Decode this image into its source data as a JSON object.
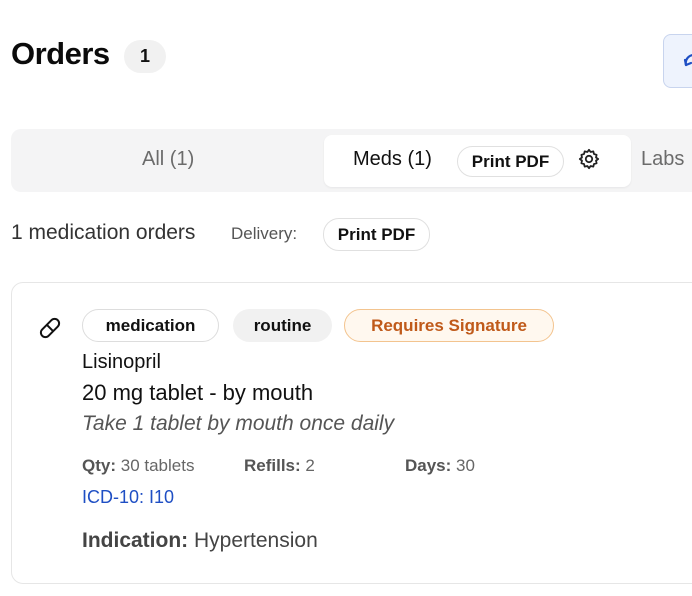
{
  "header": {
    "title": "Orders",
    "count": "1"
  },
  "tabs": {
    "all_label": "All (1)",
    "meds_label": "Meds (1)",
    "meds_print_label": "Print PDF",
    "labs_label": "Labs"
  },
  "summary": {
    "text": "1 medication orders",
    "delivery_label": "Delivery:",
    "print_label": "Print PDF"
  },
  "order": {
    "tags": {
      "type": "medication",
      "priority": "routine",
      "signature": "Requires Signature"
    },
    "drug": "Lisinopril",
    "dose": "20 mg tablet - by mouth",
    "sig": "Take 1 tablet by mouth once daily",
    "qty_label": "Qty:",
    "qty_value": "30 tablets",
    "refills_label": "Refills:",
    "refills_value": "2",
    "days_label": "Days:",
    "days_value": "30",
    "icd": "ICD-10: I10",
    "indication_label": "Indication:",
    "indication_value": "Hypertension"
  },
  "icons": {
    "pill": "pill-icon",
    "gear": "gear-icon",
    "refresh": "refresh-icon"
  },
  "colors": {
    "accent_blue": "#1f4fc4",
    "warning_orange": "#c05a1a",
    "tab_bg": "#f4f4f5"
  }
}
